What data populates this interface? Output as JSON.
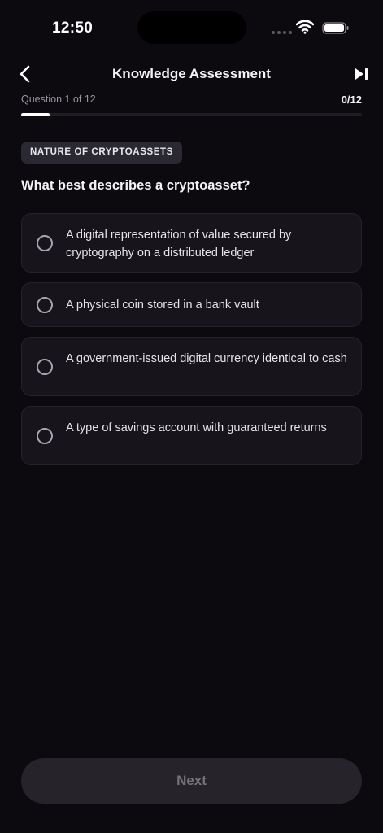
{
  "status_bar": {
    "time": "12:50",
    "icons": [
      "signal-dots-icon",
      "wifi-icon",
      "battery-icon"
    ]
  },
  "header": {
    "title": "Knowledge Assessment",
    "back_icon": "chevron-left-icon",
    "skip_icon": "skip-forward-icon"
  },
  "progress": {
    "label": "Question 1 of 12",
    "count": "0/12",
    "fraction": 0.083
  },
  "quiz": {
    "category": "NATURE OF CRYPTOASSETS",
    "question": "What best describes a cryptoasset?",
    "options": [
      {
        "label": "A digital representation of value secured by cryptography on a distributed ledger",
        "selected": false
      },
      {
        "label": "A physical coin stored in a bank vault",
        "selected": false
      },
      {
        "label": "A government-issued digital currency identical to cash",
        "selected": false
      },
      {
        "label": "A type of savings account with guaranteed returns",
        "selected": false
      }
    ]
  },
  "footer": {
    "next_label": "Next",
    "next_enabled": false
  },
  "colors": {
    "background": "#0c0a0f",
    "card": "#17151b",
    "chip": "#2a2830",
    "button_disabled": "#26242a",
    "text_primary": "#f4f2f6",
    "text_muted": "#9a96a0"
  }
}
